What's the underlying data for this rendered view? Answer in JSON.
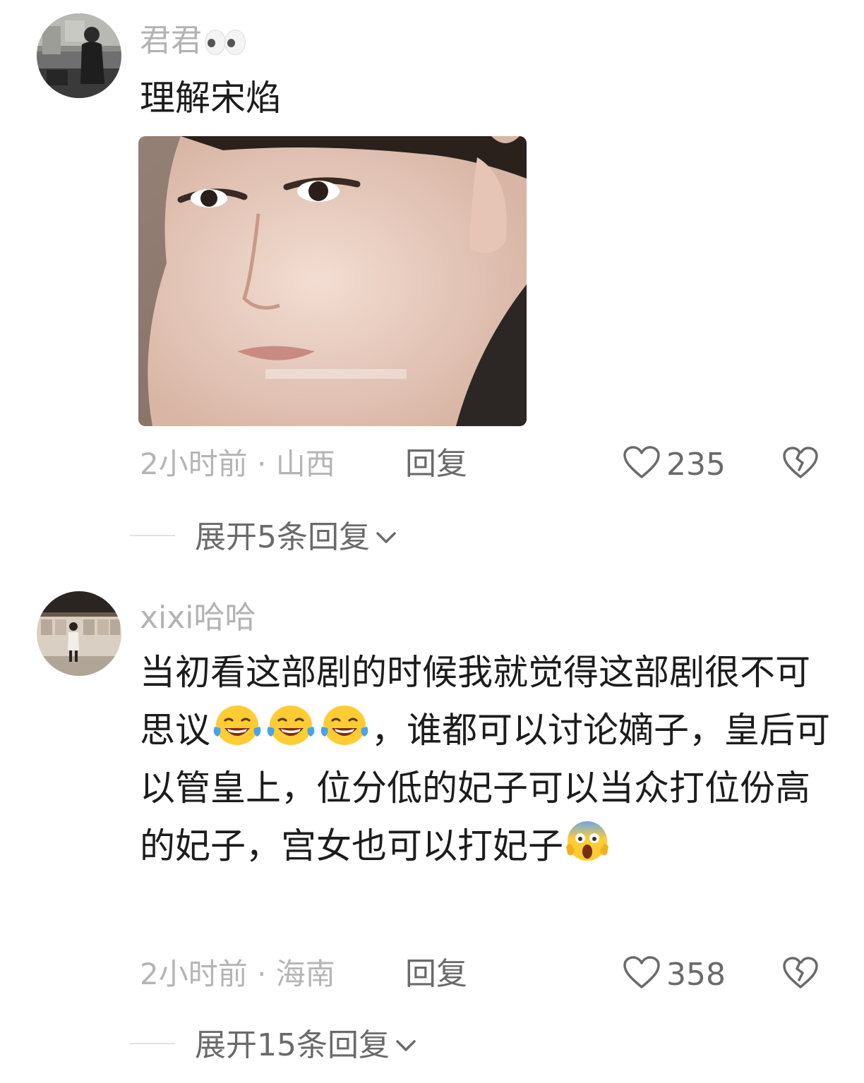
{
  "comments": [
    {
      "username": "君君",
      "text": "理解宋焰",
      "meta": "2小时前 · 山西",
      "reply_label": "回复",
      "likes": "235",
      "expand_label": "展开5条回复"
    },
    {
      "username": "xixi哈哈",
      "text_parts": [
        "当初看这部剧的时候我就觉得这部剧很不可思议",
        "，谁都可以讨论嫡子，皇后可以管皇上，位分低的妃子可以当众打位份高的妃子，宫女也可以打妃子"
      ],
      "meta": "2小时前 · 海南",
      "reply_label": "回复",
      "likes": "358",
      "expand_label": "展开15条回复"
    }
  ],
  "colors": {
    "username": "#b3b3b3",
    "body_text": "#1c1c1c",
    "meta": "#b5b5b5",
    "action": "#6a6a6a"
  },
  "icons": {
    "like": "heart-outline-icon",
    "dislike": "broken-heart-icon",
    "expand": "chevron-down-icon",
    "emoji_laugh": "tears-of-joy-emoji",
    "emoji_scream": "screaming-face-emoji"
  }
}
